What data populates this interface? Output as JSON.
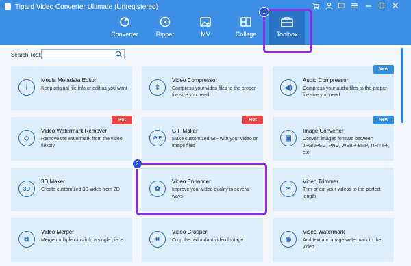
{
  "window": {
    "title": "Tipard Video Converter Ultimate (Unregistered)"
  },
  "nav": [
    {
      "label": "Converter",
      "icon": "converter-icon"
    },
    {
      "label": "Ripper",
      "icon": "disc-icon"
    },
    {
      "label": "MV",
      "icon": "image-icon"
    },
    {
      "label": "Collage",
      "icon": "collage-icon"
    },
    {
      "label": "Toolbox",
      "icon": "toolbox-icon",
      "active": true
    }
  ],
  "search": {
    "label": "Search Tool:",
    "value": ""
  },
  "annotations": {
    "step1": "1",
    "step2": "2"
  },
  "tools": [
    {
      "title": "Media Metadata Editor",
      "desc": "Keep original file info or edit as you want",
      "icon_text": "i"
    },
    {
      "title": "Video Compressor",
      "desc": "Compress your video files to the proper file size you need",
      "icon_text": "⇕"
    },
    {
      "title": "Audio Compressor",
      "desc": "Compress your audio files to the proper file size you need",
      "icon_text": "◀)",
      "tag": "New"
    },
    {
      "title": "Video Watermark Remover",
      "desc": "Remove the watermark from the video flexbly",
      "icon_text": "◇",
      "tag": "Hot"
    },
    {
      "title": "GIF Maker",
      "desc": "Make customized GIF with your video or image files",
      "icon_text": "GIF",
      "tag": "Hot"
    },
    {
      "title": "Image Converter",
      "desc": "Convert images formats between JPG/JPEG, PNG, WEBP, BMP, TIF/TIFF, etc.",
      "icon_text": "▣",
      "tag": "New"
    },
    {
      "title": "3D Maker",
      "desc": "Create customized 3D video from 2D",
      "icon_text": "3D"
    },
    {
      "title": "Video Enhancer",
      "desc": "Improve your video quality in several ways",
      "icon_text": "✿"
    },
    {
      "title": "Video Trimmer",
      "desc": "Trim or cut your videos to the perfect length",
      "icon_text": "✂"
    },
    {
      "title": "Video Merger",
      "desc": "Merge multiple clips into a single piece",
      "icon_text": "⧉"
    },
    {
      "title": "Video Cropper",
      "desc": "Crop the redundant video footage",
      "icon_text": "⌗"
    },
    {
      "title": "Video Watermark",
      "desc": "Add text and image watermark to the video",
      "icon_text": "◉"
    }
  ]
}
